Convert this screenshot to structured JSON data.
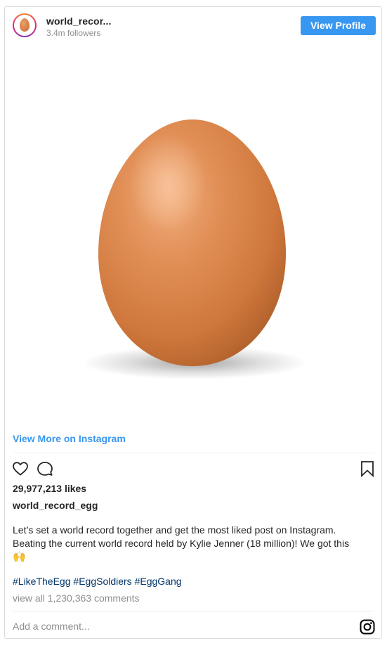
{
  "header": {
    "username": "world_recor...",
    "followers": "3.4m followers",
    "view_profile_label": "View Profile"
  },
  "post": {
    "view_more_label": "View More on Instagram",
    "likes": "29,977,213 likes",
    "caption_user": "world_record_egg",
    "caption_line1": "Let’s set a world record together and get the most liked post on Instagram.",
    "caption_line2": "Beating the current world record held by Kylie Jenner (18 million)! We got this",
    "caption_emoji": "🙌",
    "hashtags": [
      "#LikeTheEgg",
      "#EggSoldiers",
      "#EggGang"
    ],
    "view_comments_label": "view all 1,230,363 comments",
    "add_comment_placeholder": "Add a comment..."
  },
  "icons": {
    "like": "heart-icon",
    "comment": "comment-icon",
    "save": "bookmark-icon",
    "instagram": "instagram-logo-icon"
  },
  "colors": {
    "accent": "#3897f0",
    "hashtag": "#003569",
    "muted": "#8e8e8e",
    "text": "#262626"
  }
}
